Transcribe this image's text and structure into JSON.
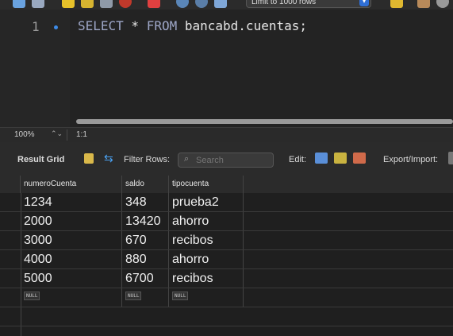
{
  "toolbar": {
    "limit_select": "Limit to 1000 rows",
    "icons": [
      "folder-icon",
      "save-icon",
      "execute-icon",
      "execute-current-icon",
      "explain-icon",
      "stop-icon",
      "toggle-error-icon",
      "commit-icon",
      "rollback-icon",
      "autocommit-icon",
      "beautify-icon",
      "find-icon"
    ]
  },
  "editor": {
    "line_number": "1",
    "sql": {
      "kw1": "SELECT",
      "star": " * ",
      "kw2": "FROM",
      "rest": " bancabd.cuentas;"
    }
  },
  "zoom_bar": {
    "zoom": "100%",
    "position": "1:1"
  },
  "result_toolbar": {
    "result_grid": "Result Grid",
    "filter_rows": "Filter Rows:",
    "search_placeholder": "Search",
    "edit": "Edit:",
    "export_import": "Export/Import:"
  },
  "grid": {
    "columns": [
      "numeroCuenta",
      "saldo",
      "tipocuenta"
    ],
    "rows": [
      [
        "1234",
        "348",
        "prueba2"
      ],
      [
        "2000",
        "13420",
        "ahorro"
      ],
      [
        "3000",
        "670",
        "recibos"
      ],
      [
        "4000",
        "880",
        "ahorro"
      ],
      [
        "5000",
        "6700",
        "recibos"
      ]
    ],
    "null_label": "NULL"
  },
  "colors": {
    "accent": "#2f6fd6",
    "keyword": "#9ea7c8",
    "background": "#1e1e1e"
  }
}
